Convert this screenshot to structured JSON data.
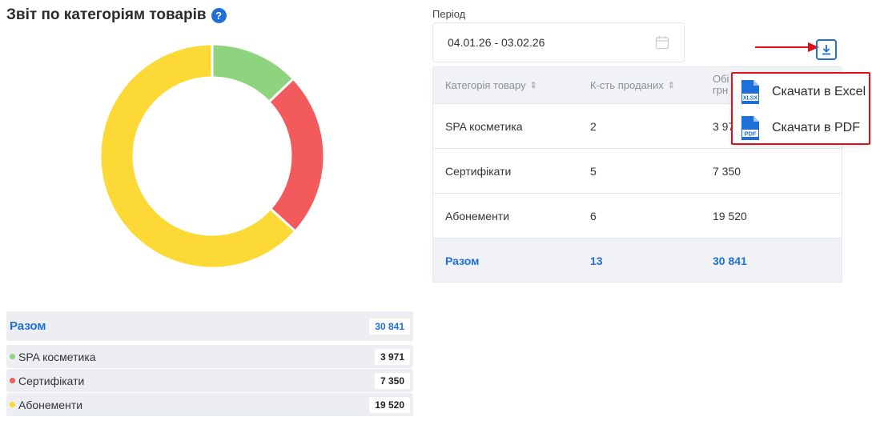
{
  "report": {
    "title": "Звіт по категоріям товарів",
    "help_icon": "?"
  },
  "legend": {
    "total_label": "Разом",
    "total_value": "30 841",
    "items": [
      {
        "name": "SPA косметика",
        "value": "3 971",
        "color": "#8ed47e"
      },
      {
        "name": "Сертифікати",
        "value": "7 350",
        "color": "#f25a5c"
      },
      {
        "name": "Абонементи",
        "value": "19 520",
        "color": "#fcd934"
      }
    ]
  },
  "chart_data": {
    "type": "pie",
    "donut": true,
    "categories": [
      "SPA косметика",
      "Сертифікати",
      "Абонементи"
    ],
    "values": [
      3971,
      7350,
      19520
    ],
    "colors": [
      "#8ed47e",
      "#f25a5c",
      "#fcd934"
    ]
  },
  "period": {
    "label": "Період",
    "value": "04.01.26 - 03.02.26"
  },
  "table": {
    "headers": [
      "Категорія товару",
      "К-сть проданих",
      "Обі грн"
    ],
    "rows": [
      [
        "SPA косметика",
        "2",
        "3 97"
      ],
      [
        "Сертифікати",
        "5",
        "7 350"
      ],
      [
        "Абонементи",
        "6",
        "19 520"
      ]
    ],
    "footer": [
      "Разом",
      "13",
      "30 841"
    ]
  },
  "download_menu": {
    "items": [
      {
        "label": "Скачати в Excel",
        "icon": "xlsx-file-icon",
        "badge": "XLSX"
      },
      {
        "label": "Скачати в PDF",
        "icon": "pdf-file-icon",
        "badge": "PDF"
      }
    ]
  }
}
